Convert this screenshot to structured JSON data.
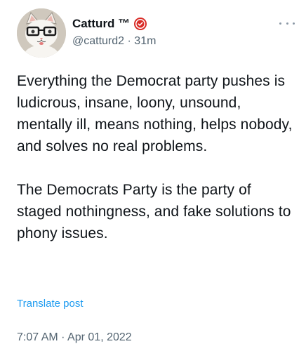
{
  "post": {
    "author": {
      "display_name": "Catturd ™",
      "handle": "@catturd2",
      "time_ago": "31m",
      "avatar_icon": "cat-avatar-icon",
      "badge_icon": "verified-check-badge-icon",
      "badge_color": "#d92b26"
    },
    "more_icon": "ellipsis-icon",
    "paragraphs": [
      "Everything the Democrat party pushes is ludicrous, insane, loony, unsound, mentally ill, means nothing, helps nobody, and solves no real problems.",
      "The Democrats Party is the party of staged nothingness,  and fake solutions to phony issues."
    ],
    "translate_label": "Translate post",
    "timestamp": {
      "time": "7:07 AM",
      "date": "Apr 01, 2022"
    }
  },
  "colors": {
    "text": "#0f1419",
    "secondary": "#536471",
    "link": "#1d9bf0"
  }
}
